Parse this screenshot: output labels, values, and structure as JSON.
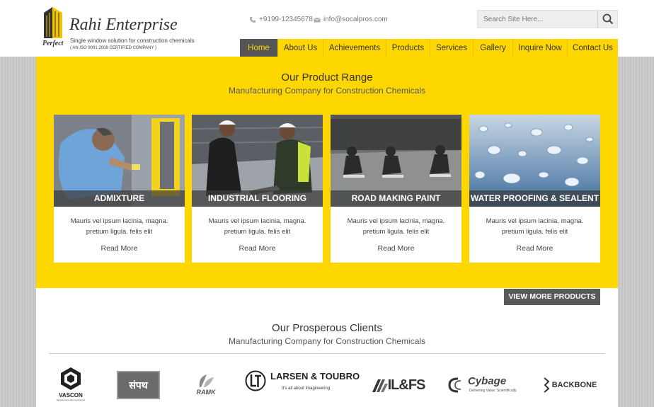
{
  "brand": {
    "name": "Rahi Enterprise",
    "prefix": "Perfect",
    "tagline": "Single window solution for construction chemicals",
    "iso": "( AN ISO 9001:2008 CERTIFIED COMPANY )"
  },
  "contact": {
    "phone": "+9199-12345678",
    "email": "info@socalpros.com"
  },
  "search": {
    "placeholder": "Search Site Here..."
  },
  "nav": {
    "items": [
      {
        "label": "Home",
        "active": true
      },
      {
        "label": "About Us"
      },
      {
        "label": "Achievements"
      },
      {
        "label": "Products"
      },
      {
        "label": "Services"
      },
      {
        "label": "Gallery"
      },
      {
        "label": "Inquire Now"
      },
      {
        "label": "Contact Us"
      }
    ]
  },
  "products": {
    "title": "Our Product Range",
    "subtitle": "Manufacturing Company for Construction Chemicals",
    "cards": [
      {
        "label": "ADMIXTURE",
        "desc": "Mauris vel ipsum lacinia, magna. pretium ligula. felis elit",
        "more": "Read More"
      },
      {
        "label": "INDUSTRIAL FLOORING",
        "desc": "Mauris vel ipsum lacinia, magna. pretium ligula. felis elit",
        "more": "Read More"
      },
      {
        "label": "ROAD MAKING PAINT",
        "desc": "Mauris vel ipsum lacinia, magna. pretium ligula. felis elit",
        "more": "Read More"
      },
      {
        "label": "WATER PROOFING & SEALENT",
        "desc": "Mauris vel ipsum lacinia, magna. pretium ligula. felis elit",
        "more": "Read More"
      }
    ],
    "view_more": "VIEW MORE PRODUCTS"
  },
  "clients": {
    "title": "Our Prosperous Clients",
    "subtitle": "Manufacturing Company for Construction Chemicals",
    "logos": [
      {
        "name": "VASCON",
        "sub": "Development with Conscience"
      },
      {
        "name": "संपथ"
      },
      {
        "name": "RAMK"
      },
      {
        "name": "LARSEN & TOUBRO",
        "sub": "It's all about Imagineering"
      },
      {
        "name": "IL&FS"
      },
      {
        "name": "Cybage",
        "sub": "Delivering Value. Scientifically."
      },
      {
        "name": "BACKBONE"
      }
    ]
  },
  "colors": {
    "accent": "#ffd700",
    "nav_active_bg": "#555555",
    "button_bg": "#595959"
  }
}
